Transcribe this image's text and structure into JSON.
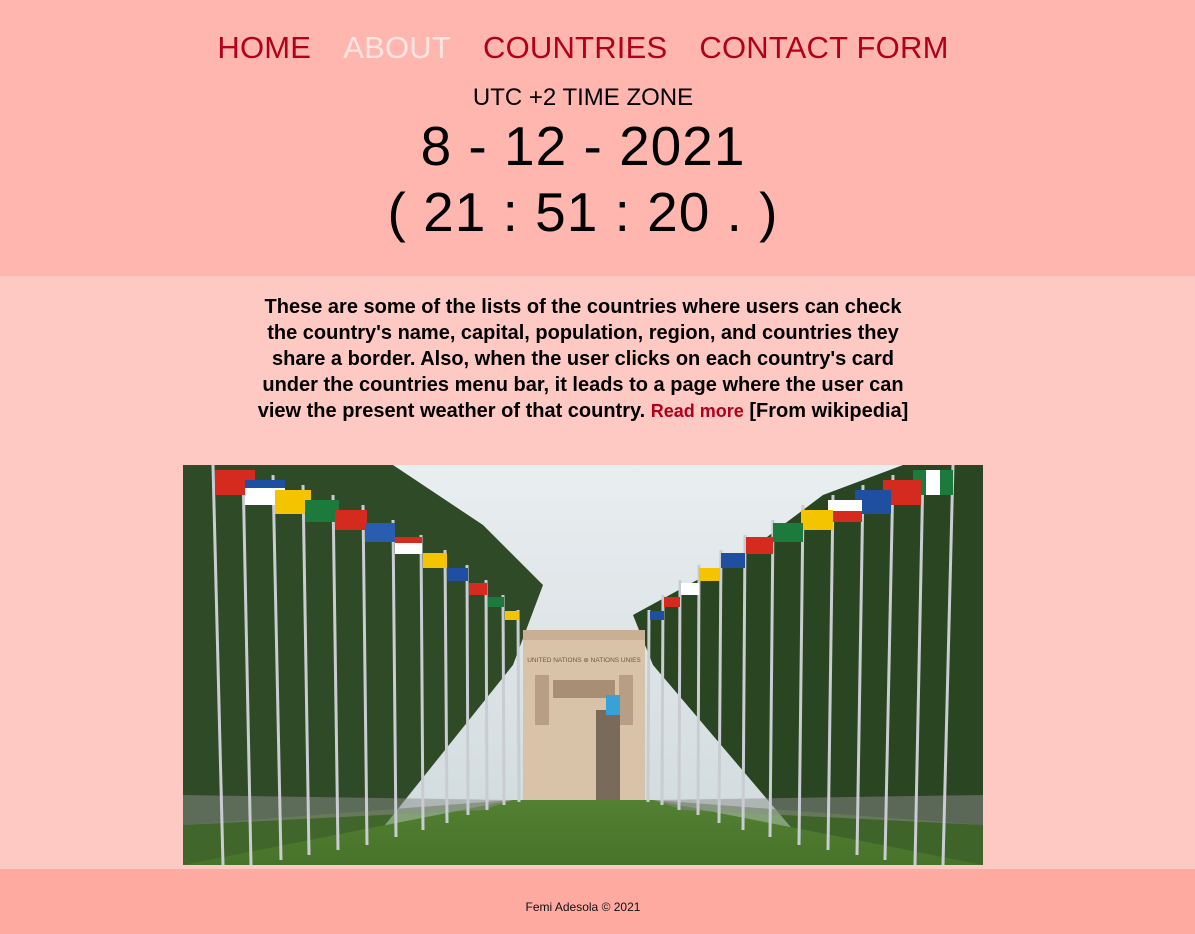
{
  "nav": {
    "items": [
      {
        "label": "HOME"
      },
      {
        "label": "ABOUT"
      },
      {
        "label": "COUNTRIES"
      },
      {
        "label": "CONTACT FORM"
      }
    ],
    "active": "ABOUT"
  },
  "clock": {
    "timezone_label": "UTC +2 TIME ZONE",
    "date": "8 - 12 - 2021",
    "time": "( 21 : 51 : 20 . )"
  },
  "about": {
    "text": "These are some of the lists of the countries where users can check the country's name, capital, population, region, and countries they share a border. Also, when the user clicks on each country's card under the countries menu bar, it leads to a page where the user can view the present weather of that country.",
    "read_more": "Read more",
    "source": "[From wikipedia]"
  },
  "image": {
    "subject": "United Nations building with rows of national flags",
    "building_sign": "UNITED NATIONS ⊕ NATIONS UNIES"
  },
  "footer": {
    "text": "Femi Adesola © 2021"
  },
  "colors": {
    "header_bg": "#ffb6af",
    "body_bg": "#ffc9c3",
    "footer_bg": "#ffaaa1",
    "nav_link": "#b0001a",
    "nav_active": "#ffe6e3"
  }
}
